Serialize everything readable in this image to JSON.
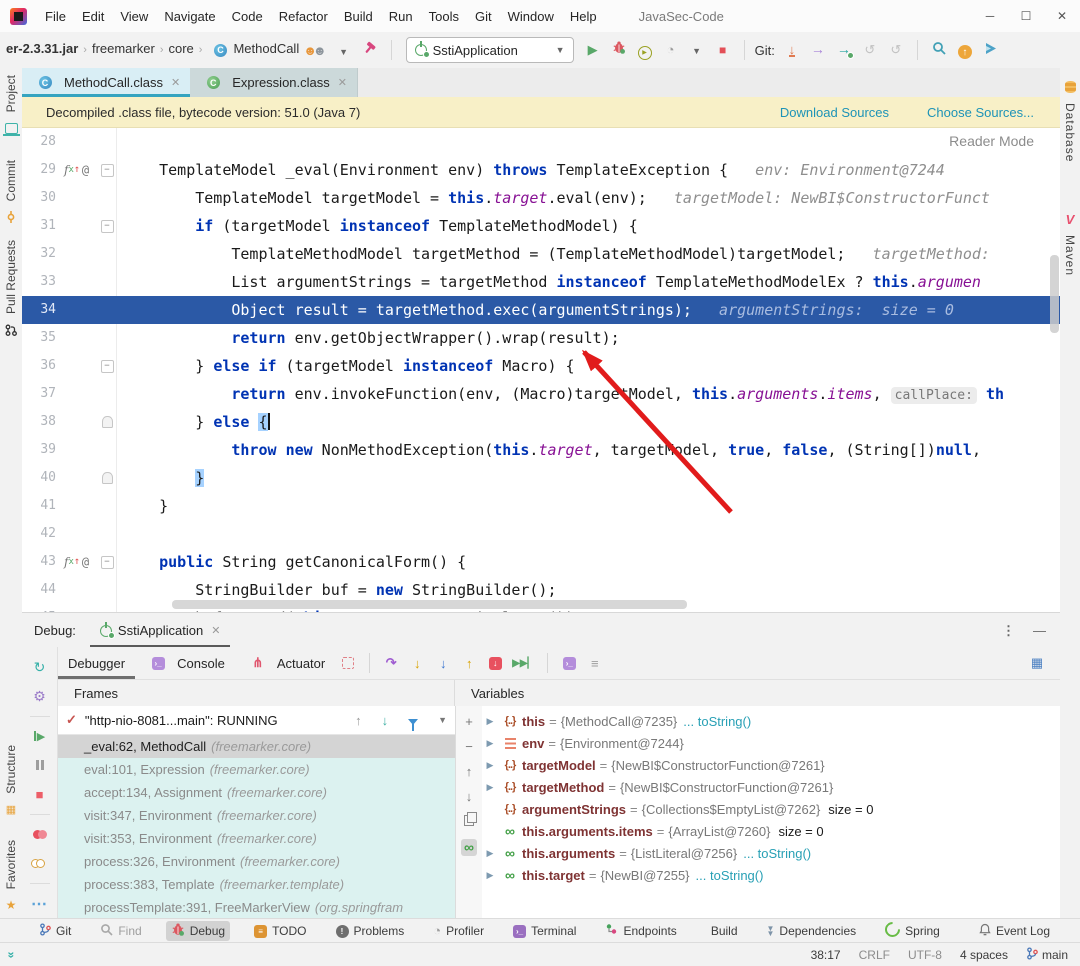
{
  "colors": {
    "accent_teal": "#35a4c0",
    "execution_line": "#2b59a6",
    "banner_bg": "#f8f0c7",
    "link": "#1d93b7",
    "frames_bg": "#dcf2f0",
    "keyword": "#0033b3",
    "field": "#871094",
    "annotation_arrow": "#e11b1b"
  },
  "titlebar": {
    "title": "JavaSec-Code",
    "menus": [
      "File",
      "Edit",
      "View",
      "Navigate",
      "Code",
      "Refactor",
      "Build",
      "Run",
      "Tools",
      "Git",
      "Window",
      "Help"
    ],
    "window_controls": [
      "minimize",
      "maximize",
      "close"
    ]
  },
  "toolbar": {
    "breadcrumbs": [
      "er-2.3.31.jar",
      "freemarker",
      "core",
      "MethodCall"
    ],
    "run_config": "SstiApplication",
    "git_label": "Git:",
    "left_icons": [
      {
        "icon": "users",
        "name": "code-with-me-users-icon"
      },
      {
        "icon": "caret",
        "name": "users-dropdown-caret"
      },
      {
        "icon": "hammer",
        "name": "build-hammer-icon"
      }
    ],
    "right_icons": [
      {
        "icon": "play",
        "name": "run-button"
      },
      {
        "icon": "bug",
        "name": "debug-button"
      },
      {
        "icon": "coverage",
        "name": "run-with-coverage-button"
      },
      {
        "icon": "gauge",
        "name": "profiler-button"
      },
      {
        "icon": "caret",
        "name": "profiler-dropdown-caret"
      },
      {
        "icon": "stop",
        "name": "stop-button"
      }
    ],
    "git_icons": [
      {
        "icon": "gitdl",
        "name": "git-update-project-button"
      },
      {
        "icon": "gitpush",
        "name": "git-push-button"
      },
      {
        "icon": "gitteal",
        "name": "git-commit-push-button"
      },
      {
        "icon": "hist",
        "name": "git-history-button"
      },
      {
        "icon": "hist",
        "name": "git-rollback-button"
      }
    ],
    "far_icons": [
      {
        "icon": "search",
        "name": "search-everywhere-icon"
      },
      {
        "icon": "upg",
        "name": "update-available-icon"
      },
      {
        "icon": "blueplay",
        "name": "ide-services-icon"
      }
    ]
  },
  "editor_tabs": [
    {
      "label": "MethodCall.class",
      "active": true,
      "icon": "class"
    },
    {
      "label": "Expression.class",
      "active": false,
      "icon": "classg"
    }
  ],
  "banner": {
    "text": "Decompiled .class file, bytecode version: 51.0 (Java 7)",
    "links": [
      "Download Sources",
      "Choose Sources..."
    ]
  },
  "left_strip": [
    {
      "label": "Project",
      "icon": "project"
    },
    {
      "label": "Commit",
      "icon": "commit"
    },
    {
      "label": "Pull Requests",
      "icon": "pr"
    }
  ],
  "left_strip_lower": [
    {
      "label": "Structure",
      "icon": "structure"
    },
    {
      "label": "Favorites",
      "icon": "star"
    }
  ],
  "right_strip": [
    {
      "label": "Database",
      "icon": "db"
    },
    {
      "label": "Maven",
      "icon": "maven"
    }
  ],
  "editor": {
    "reader_mode": "Reader Mode",
    "lines": [
      {
        "n": 28,
        "seg": []
      },
      {
        "n": 29,
        "ov": true,
        "fold": "box",
        "seg": [
          [
            "p",
            "    TemplateModel _eval(Environment env) "
          ],
          [
            "k",
            "throws"
          ],
          [
            "p",
            " TemplateException {"
          ],
          [
            "h",
            "   env: Environment@7244"
          ]
        ]
      },
      {
        "n": 30,
        "seg": [
          [
            "p",
            "        TemplateModel targetModel = "
          ],
          [
            "k",
            "this"
          ],
          [
            "p",
            "."
          ],
          [
            "f",
            "target"
          ],
          [
            "p",
            ".eval(env);"
          ],
          [
            "h",
            "   targetModel: NewBI$ConstructorFunct"
          ]
        ]
      },
      {
        "n": 31,
        "fold": "box",
        "seg": [
          [
            "p",
            "        "
          ],
          [
            "k",
            "if"
          ],
          [
            "p",
            " (targetModel "
          ],
          [
            "k",
            "instanceof"
          ],
          [
            "p",
            " TemplateMethodModel) {"
          ]
        ]
      },
      {
        "n": 32,
        "seg": [
          [
            "p",
            "            TemplateMethodModel targetMethod = (TemplateMethodModel)targetModel;"
          ],
          [
            "h",
            "   targetMethod:"
          ]
        ]
      },
      {
        "n": 33,
        "seg": [
          [
            "p",
            "            List argumentStrings = targetMethod "
          ],
          [
            "k",
            "instanceof"
          ],
          [
            "p",
            " TemplateMethodModelEx ? "
          ],
          [
            "k",
            "this"
          ],
          [
            "p",
            "."
          ],
          [
            "f",
            "argumen"
          ]
        ]
      },
      {
        "n": 34,
        "cur": true,
        "seg": [
          [
            "p",
            "            Object result = targetMethod.exec(argumentStrings);"
          ],
          [
            "h",
            "   argumentStrings:  size = 0"
          ]
        ]
      },
      {
        "n": 35,
        "seg": [
          [
            "p",
            "            "
          ],
          [
            "k",
            "return"
          ],
          [
            "p",
            " env.getObjectWrapper().wrap(result);"
          ]
        ]
      },
      {
        "n": 36,
        "fold": "box",
        "seg": [
          [
            "p",
            "        } "
          ],
          [
            "k",
            "else"
          ],
          [
            "p",
            " "
          ],
          [
            "k",
            "if"
          ],
          [
            "p",
            " (targetModel "
          ],
          [
            "k",
            "instanceof"
          ],
          [
            "p",
            " Macro) {"
          ]
        ]
      },
      {
        "n": 37,
        "seg": [
          [
            "p",
            "            "
          ],
          [
            "k",
            "return"
          ],
          [
            "p",
            " env.invokeFunction(env, (Macro)targetModel, "
          ],
          [
            "k",
            "this"
          ],
          [
            "p",
            "."
          ],
          [
            "f",
            "arguments"
          ],
          [
            "p",
            "."
          ],
          [
            "f",
            "items"
          ],
          [
            "p",
            ", "
          ],
          [
            "chip",
            "callPlace:"
          ],
          [
            "p",
            " "
          ],
          [
            "k",
            "th"
          ]
        ]
      },
      {
        "n": 38,
        "fold": "lock",
        "seg": [
          [
            "p",
            "        } "
          ],
          [
            "k",
            "else"
          ],
          [
            "p",
            " "
          ],
          [
            "brace",
            "{"
          ],
          [
            "caret",
            ""
          ]
        ]
      },
      {
        "n": 39,
        "seg": [
          [
            "p",
            "            "
          ],
          [
            "k",
            "throw"
          ],
          [
            "p",
            " "
          ],
          [
            "k",
            "new"
          ],
          [
            "p",
            " NonMethodException("
          ],
          [
            "k",
            "this"
          ],
          [
            "p",
            "."
          ],
          [
            "f",
            "target"
          ],
          [
            "p",
            ", targetModel, "
          ],
          [
            "k",
            "true"
          ],
          [
            "p",
            ", "
          ],
          [
            "k",
            "false"
          ],
          [
            "p",
            ", (String[])"
          ],
          [
            "k",
            "null"
          ],
          [
            "p",
            ","
          ]
        ]
      },
      {
        "n": 40,
        "fold": "lock",
        "seg": [
          [
            "p",
            "        "
          ],
          [
            "brace",
            "}"
          ]
        ]
      },
      {
        "n": 41,
        "seg": [
          [
            "p",
            "    }"
          ]
        ]
      },
      {
        "n": 42,
        "seg": []
      },
      {
        "n": 43,
        "ov": true,
        "fold": "box",
        "seg": [
          [
            "p",
            "    "
          ],
          [
            "k",
            "public"
          ],
          [
            "p",
            " String getCanonicalForm() {"
          ]
        ]
      },
      {
        "n": 44,
        "seg": [
          [
            "p",
            "        StringBuilder buf = "
          ],
          [
            "k",
            "new"
          ],
          [
            "p",
            " StringBuilder();"
          ]
        ]
      },
      {
        "n": 45,
        "seg": [
          [
            "p",
            "        buf.append("
          ],
          [
            "k",
            "this"
          ],
          [
            "p",
            "."
          ],
          [
            "f",
            "target"
          ],
          [
            "p",
            ".getCanonicalForm());"
          ]
        ]
      }
    ]
  },
  "debug": {
    "label": "Debug:",
    "session": "SstiApplication",
    "tabs": [
      {
        "label": "Debugger",
        "active": true,
        "icon": null
      },
      {
        "label": "Console",
        "active": false,
        "icon": "term"
      },
      {
        "label": "Actuator",
        "active": false,
        "icon": "actuator"
      }
    ],
    "step_icons": [
      {
        "icon": "stepover",
        "name": "step-over-button"
      },
      {
        "icon": "stepinto",
        "name": "step-into-button"
      },
      {
        "icon": "forcestep",
        "name": "force-step-into-button"
      },
      {
        "icon": "stepout",
        "name": "step-out-button"
      },
      {
        "icon": "dropframe",
        "name": "drop-frame-button"
      },
      {
        "icon": "runtocursor",
        "name": "run-to-cursor-button"
      }
    ],
    "strip_icons": [
      {
        "icon": "rerun",
        "name": "rerun-button"
      },
      {
        "icon": "gear",
        "name": "debug-settings-button"
      },
      {
        "icon": "resume",
        "name": "resume-button"
      },
      {
        "icon": "pause",
        "name": "pause-button"
      },
      {
        "icon": "stopsq",
        "name": "stop-process-button"
      },
      {
        "icon": "viewbp",
        "name": "view-breakpoints-button"
      },
      {
        "icon": "mutebp",
        "name": "mute-breakpoints-button"
      },
      {
        "icon": "more",
        "name": "more-actions-button"
      }
    ],
    "frames_title": "Frames",
    "variables_title": "Variables",
    "thread": "\"http-nio-8081...main\": RUNNING",
    "frames": [
      {
        "loc": "_eval:62, MethodCall",
        "pkg": "(freemarker.core)",
        "selected": true
      },
      {
        "loc": "eval:101, Expression",
        "pkg": "(freemarker.core)"
      },
      {
        "loc": "accept:134, Assignment",
        "pkg": "(freemarker.core)"
      },
      {
        "loc": "visit:347, Environment",
        "pkg": "(freemarker.core)"
      },
      {
        "loc": "visit:353, Environment",
        "pkg": "(freemarker.core)"
      },
      {
        "loc": "process:326, Environment",
        "pkg": "(freemarker.core)"
      },
      {
        "loc": "process:383, Template",
        "pkg": "(freemarker.template)"
      },
      {
        "loc": "processTemplate:391, FreeMarkerView",
        "pkg": "(org.springfram"
      }
    ],
    "variables": [
      {
        "chev": true,
        "icon": "braces",
        "name": "this",
        "value": "{MethodCall@7235}",
        "link": "... toString()"
      },
      {
        "chev": true,
        "icon": "param",
        "name": "env",
        "value": "{Environment@7244}"
      },
      {
        "chev": true,
        "icon": "braces",
        "name": "targetModel",
        "value": "{NewBI$ConstructorFunction@7261}"
      },
      {
        "chev": true,
        "icon": "braces",
        "name": "targetMethod",
        "value": "{NewBI$ConstructorFunction@7261}"
      },
      {
        "chev": false,
        "icon": "braces",
        "name": "argumentStrings",
        "value": "{Collections$EmptyList@7262}",
        "size": "size = 0"
      },
      {
        "chev": false,
        "icon": "watch",
        "name": "this.arguments.items",
        "value": "{ArrayList@7260}",
        "size": "size = 0"
      },
      {
        "chev": true,
        "icon": "watch",
        "name": "this.arguments",
        "value": "{ListLiteral@7256}",
        "link": "... toString()"
      },
      {
        "chev": true,
        "icon": "watch",
        "name": "this.target",
        "value": "{NewBI@7255}",
        "link": "... toString()"
      }
    ],
    "var_strip_icons": [
      {
        "icon": "plus",
        "name": "add-watch-button"
      },
      {
        "icon": "minus",
        "name": "remove-watch-button"
      },
      {
        "icon": "upgray2",
        "name": "move-watch-up-button"
      },
      {
        "icon": "downgray",
        "name": "move-watch-down-button"
      },
      {
        "icon": "copy",
        "name": "duplicate-watch-button"
      },
      {
        "icon": "glasses",
        "name": "show-watches-toggle",
        "selected": true
      }
    ]
  },
  "bottom_bar": {
    "items": [
      {
        "label": "Git",
        "icon": "gitbr"
      },
      {
        "label": "Find",
        "icon": "findic",
        "disabled": true
      },
      {
        "label": "Debug",
        "icon": "bug",
        "active": true
      },
      {
        "label": "TODO",
        "icon": "todo"
      },
      {
        "label": "Problems",
        "icon": "problems"
      },
      {
        "label": "Profiler",
        "icon": "gauge"
      },
      {
        "label": "Terminal",
        "icon": "terminal"
      },
      {
        "label": "Endpoints",
        "icon": "endpoints"
      },
      {
        "label": "Build",
        "icon": "build"
      },
      {
        "label": "Dependencies",
        "icon": "deps"
      },
      {
        "label": "Spring",
        "icon": "spring"
      }
    ],
    "right_label": "Event Log"
  },
  "status_bar": {
    "position": "38:17",
    "line_ending": "CRLF",
    "encoding": "UTF-8",
    "indent": "4 spaces",
    "branch": "main"
  }
}
